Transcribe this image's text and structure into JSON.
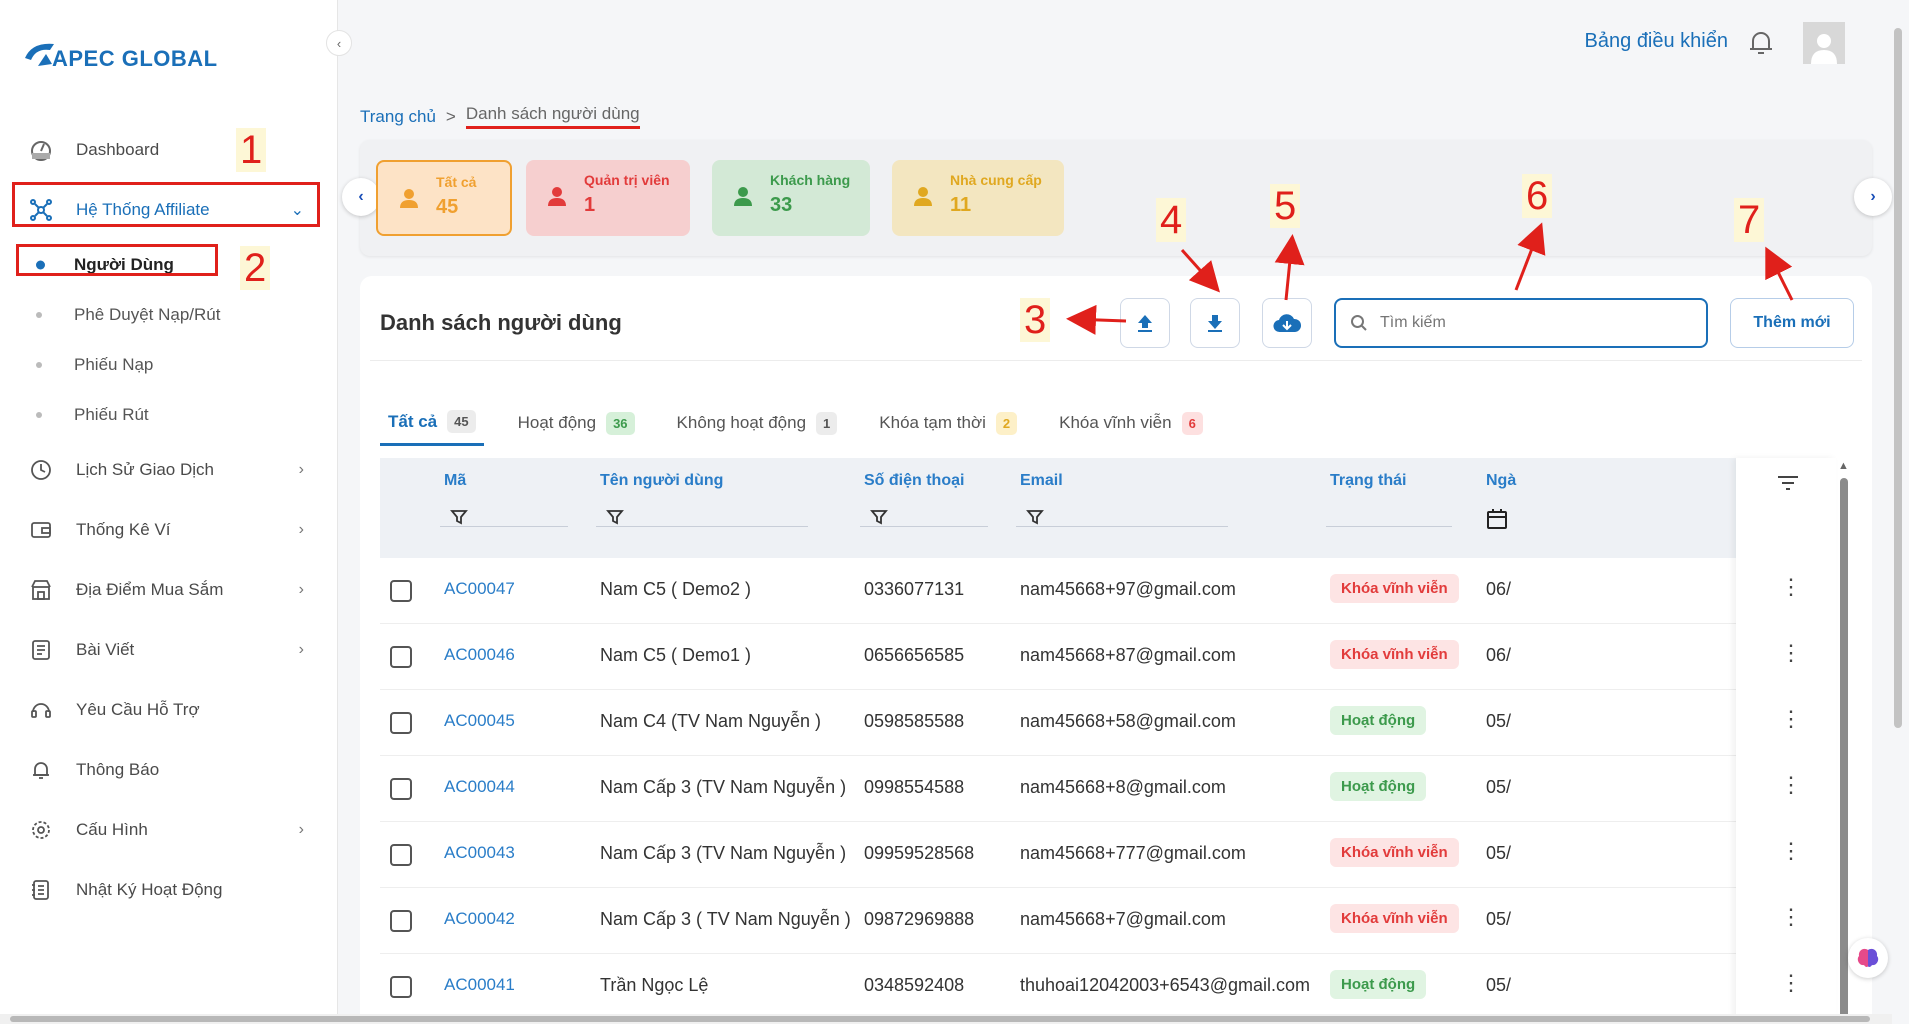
{
  "brand": {
    "name": "APEC GLOBAL"
  },
  "sidebar": {
    "items": [
      {
        "label": "Dashboard",
        "icon": "dashboard-icon"
      },
      {
        "label": "Hệ Thống Affiliate",
        "icon": "network-icon",
        "active": true
      },
      {
        "label": "Lịch Sử Giao Dịch",
        "icon": "history-icon"
      },
      {
        "label": "Thống Kê Ví",
        "icon": "wallet-icon"
      },
      {
        "label": "Địa Điểm Mua Sắm",
        "icon": "store-icon"
      },
      {
        "label": "Bài Viết",
        "icon": "article-icon"
      },
      {
        "label": "Yêu Cầu Hỗ Trợ",
        "icon": "support-icon"
      },
      {
        "label": "Thông Báo",
        "icon": "bell-icon"
      },
      {
        "label": "Cấu Hình",
        "icon": "gear-icon"
      },
      {
        "label": "Nhật Ký Hoạt Động",
        "icon": "log-icon"
      }
    ],
    "subitems": [
      {
        "label": "Người Dùng",
        "active": true
      },
      {
        "label": "Phê Duyệt Nạp/Rút"
      },
      {
        "label": "Phiếu Nạp"
      },
      {
        "label": "Phiếu Rút"
      }
    ]
  },
  "header": {
    "dashboard_link": "Bảng điều khiển"
  },
  "breadcrumb": {
    "home": "Trang chủ",
    "sep": ">",
    "current": "Danh sách người dùng"
  },
  "stats": [
    {
      "label": "Tất cả",
      "value": "45",
      "bg": "#fde3c6",
      "fg": "#f0a030",
      "border": "#f0a030"
    },
    {
      "label": "Quản trị viên",
      "value": "1",
      "bg": "#f6cfcf",
      "fg": "#e23b3b"
    },
    {
      "label": "Khách hàng",
      "value": "33",
      "bg": "#d3e9d6",
      "fg": "#3c9a4c"
    },
    {
      "label": "Nhà cung cấp",
      "value": "11",
      "bg": "#f3e6c0",
      "fg": "#e0a820"
    }
  ],
  "panel": {
    "title": "Danh sách người dùng",
    "search_placeholder": "Tìm kiếm",
    "add_label": "Thêm mới"
  },
  "tabs": [
    {
      "label": "Tất cả",
      "count": "45",
      "bg": "#ececec",
      "fg": "#555"
    },
    {
      "label": "Hoạt động",
      "count": "36",
      "bg": "#d6f0d9",
      "fg": "#3c9a4c"
    },
    {
      "label": "Không hoạt động",
      "count": "1",
      "bg": "#ececec",
      "fg": "#555"
    },
    {
      "label": "Khóa tạm thời",
      "count": "2",
      "bg": "#fdf0c8",
      "fg": "#e0a820"
    },
    {
      "label": "Khóa vĩnh viễn",
      "count": "6",
      "bg": "#fde0e0",
      "fg": "#e23b3b"
    }
  ],
  "table": {
    "columns": [
      "Mã",
      "Tên người dùng",
      "Số điện thoại",
      "Email",
      "Trạng thái",
      "Ngà"
    ],
    "rows": [
      {
        "code": "AC00047",
        "name": "Nam C5 ( Demo2 )",
        "phone": "0336077131",
        "email": "nam45668+97@gmail.com",
        "status": "Khóa vĩnh viễn",
        "status_type": "lock",
        "date": "06/"
      },
      {
        "code": "AC00046",
        "name": "Nam C5 ( Demo1 )",
        "phone": "0656656585",
        "email": "nam45668+87@gmail.com",
        "status": "Khóa vĩnh viễn",
        "status_type": "lock",
        "date": "06/"
      },
      {
        "code": "AC00045",
        "name": "Nam C4 (TV Nam Nguyễn )",
        "phone": "0598585588",
        "email": "nam45668+58@gmail.com",
        "status": "Hoạt động",
        "status_type": "ok",
        "date": "05/"
      },
      {
        "code": "AC00044",
        "name": "Nam Cấp 3 (TV Nam Nguyễn )",
        "phone": "0998554588",
        "email": "nam45668+8@gmail.com",
        "status": "Hoạt động",
        "status_type": "ok",
        "date": "05/"
      },
      {
        "code": "AC00043",
        "name": "Nam Cấp 3 (TV Nam Nguyễn )",
        "phone": "09959528568",
        "email": "nam45668+777@gmail.com",
        "status": "Khóa vĩnh viễn",
        "status_type": "lock",
        "date": "05/"
      },
      {
        "code": "AC00042",
        "name": "Nam Cấp 3 ( TV Nam Nguyễn )",
        "phone": "09872969888",
        "email": "nam45668+7@gmail.com",
        "status": "Khóa vĩnh viễn",
        "status_type": "lock",
        "date": "05/"
      },
      {
        "code": "AC00041",
        "name": "Trần Ngọc Lệ",
        "phone": "0348592408",
        "email": "thuhoai12042003+6543@gmail.com",
        "status": "Hoạt động",
        "status_type": "ok",
        "date": "05/"
      }
    ]
  },
  "annotations": [
    "1",
    "2",
    "3",
    "4",
    "5",
    "6",
    "7"
  ],
  "colors": {
    "accent": "#1a6fb8",
    "annotation": "#e0201b"
  }
}
